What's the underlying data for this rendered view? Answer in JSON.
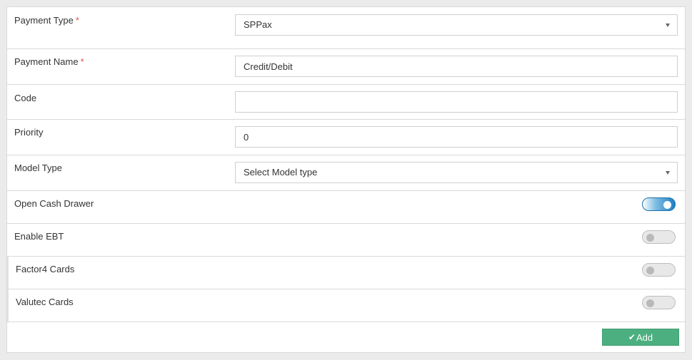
{
  "form": {
    "payment_type": {
      "label": "Payment Type",
      "required_mark": "*",
      "value": "SPPax"
    },
    "payment_name": {
      "label": "Payment Name",
      "required_mark": "*",
      "value": "Credit/Debit"
    },
    "code": {
      "label": "Code",
      "value": ""
    },
    "priority": {
      "label": "Priority",
      "value": "0"
    },
    "model_type": {
      "label": "Model Type",
      "value": "Select Model type"
    },
    "open_cash_drawer": {
      "label": "Open Cash Drawer",
      "enabled": true
    },
    "enable_ebt": {
      "label": "Enable EBT",
      "enabled": false
    },
    "factor4_cards": {
      "label": "Factor4 Cards",
      "enabled": false
    },
    "valutec_cards": {
      "label": "Valutec Cards",
      "enabled": false
    }
  },
  "actions": {
    "add_label": "Add",
    "add_icon": "check-icon",
    "add_color": "#4caf7f"
  },
  "colors": {
    "required": "#d9534f",
    "toggle_on": "#1f7fc4"
  }
}
